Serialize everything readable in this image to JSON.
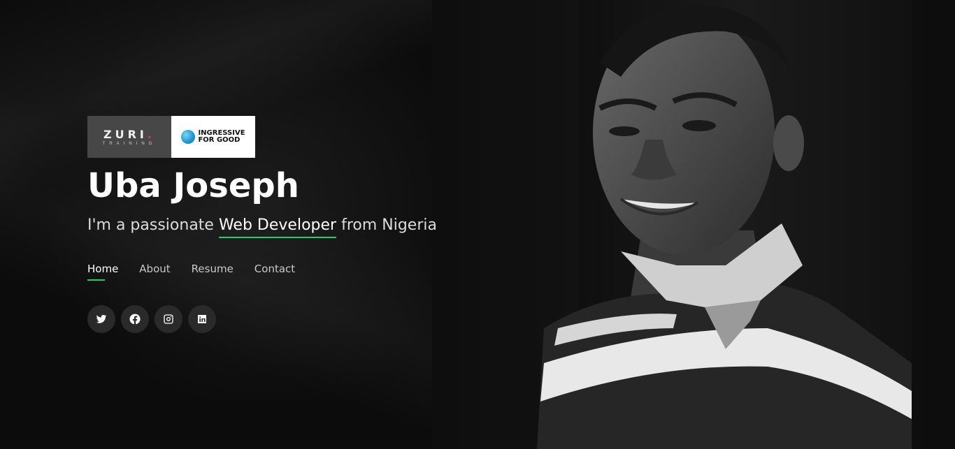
{
  "sponsors": {
    "zuri_main": "ZURI",
    "zuri_sub": "TRAINING",
    "ingressive_line1": "INGRESSIVE",
    "ingressive_line2": "FOR GOOD"
  },
  "hero": {
    "name": "Uba Joseph",
    "tagline_prefix": "I'm a passionate ",
    "tagline_highlight": "Web Developer",
    "tagline_suffix": " from Nigeria"
  },
  "nav": {
    "items": [
      {
        "label": "Home",
        "active": true
      },
      {
        "label": "About"
      },
      {
        "label": "Resume"
      },
      {
        "label": "Contact"
      }
    ]
  },
  "social": {
    "icons": [
      "twitter-icon",
      "facebook-icon",
      "instagram-icon",
      "linkedin-icon"
    ]
  },
  "colors": {
    "accent": "#18d26e",
    "background": "#0b0b0b",
    "social_button": "#2a2a2a"
  }
}
